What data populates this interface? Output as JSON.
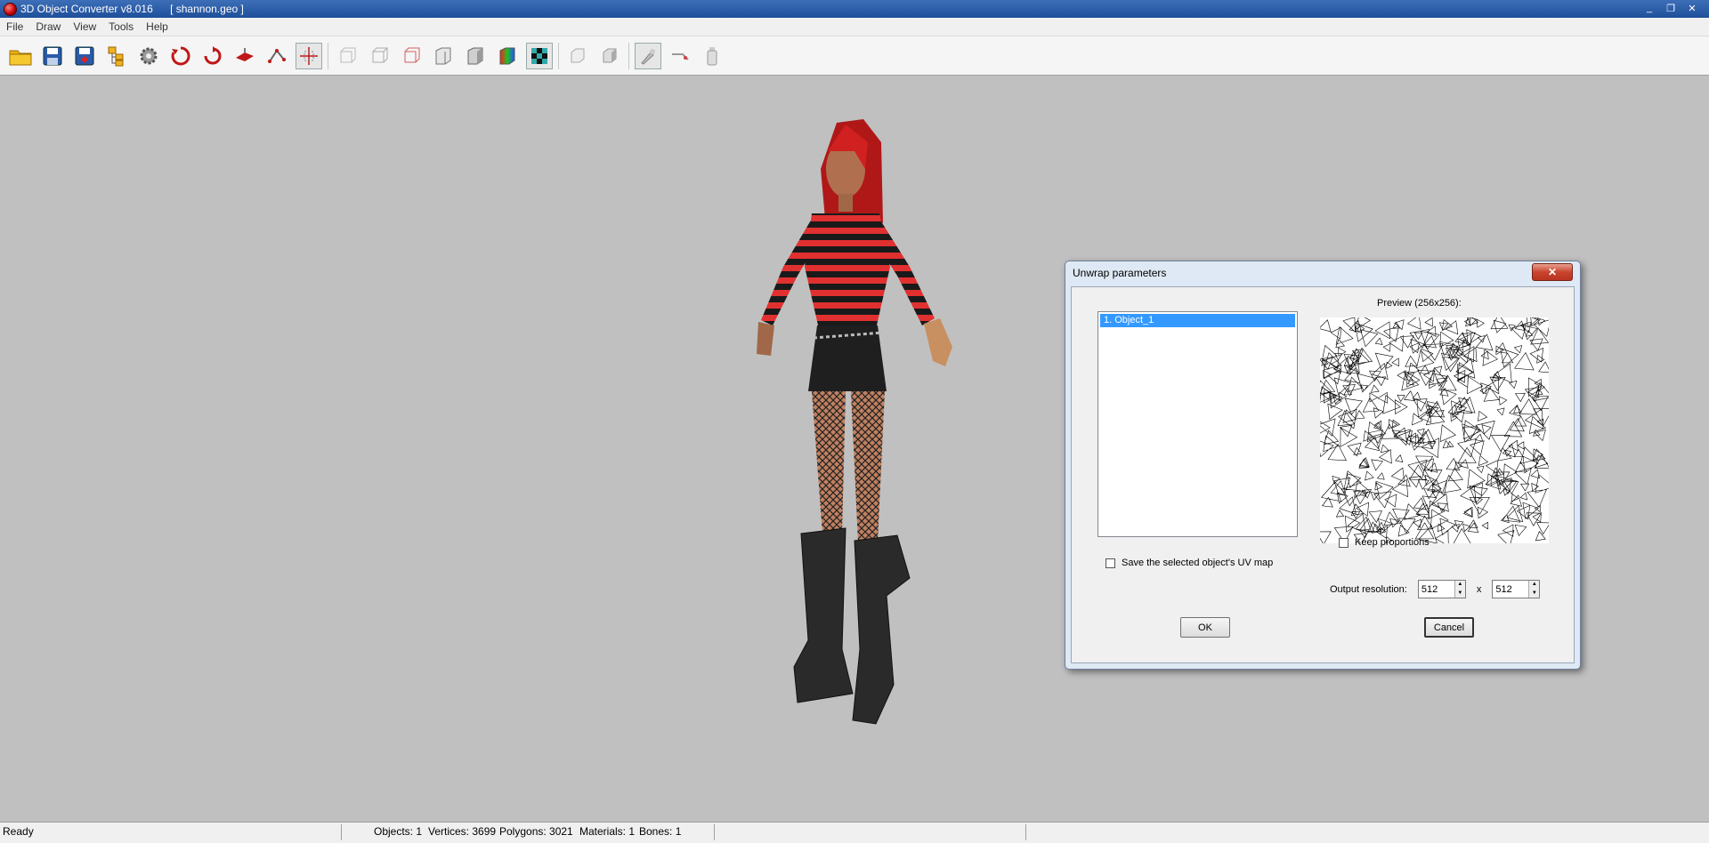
{
  "window": {
    "app_title": "3D Object Converter v8.016",
    "file_name": "[ shannon.geo ]",
    "minimize": "_",
    "restore": "❐",
    "close": "✕"
  },
  "menu": [
    "File",
    "Draw",
    "View",
    "Tools",
    "Help"
  ],
  "toolbar_icons": [
    "open-folder-icon",
    "save-icon",
    "save-as-icon",
    "hierarchy-icon",
    "settings-gear-icon",
    "rotate-x-icon",
    "rotate-y-icon",
    "rotate-z-icon",
    "bone-icon",
    "axes-icon",
    "view-front-icon",
    "view-side-icon",
    "view-top-icon",
    "solid-cube-icon",
    "shaded-cube-icon",
    "color-cube-icon",
    "checker-texture-icon",
    "light-icon",
    "light2-icon",
    "paint-brush-icon",
    "tool-icon",
    "bottle-icon"
  ],
  "dialog": {
    "title": "Unwrap parameters",
    "close": "✕",
    "objects": [
      "1.   Object_1"
    ],
    "preview_label": "Preview (256x256):",
    "save_uv_label": "Save the selected object's UV map",
    "keep_proportions_label": "Keep proportions",
    "output_resolution_label": "Output resolution:",
    "res_x": "512",
    "res_y": "512",
    "times": "x",
    "ok": "OK",
    "cancel": "Cancel"
  },
  "status": {
    "ready": "Ready",
    "objects": "Objects: 1",
    "vertices": "Vertices: 3699",
    "polygons": "Polygons: 3021",
    "materials": "Materials: 1",
    "bones": "Bones: 1"
  }
}
